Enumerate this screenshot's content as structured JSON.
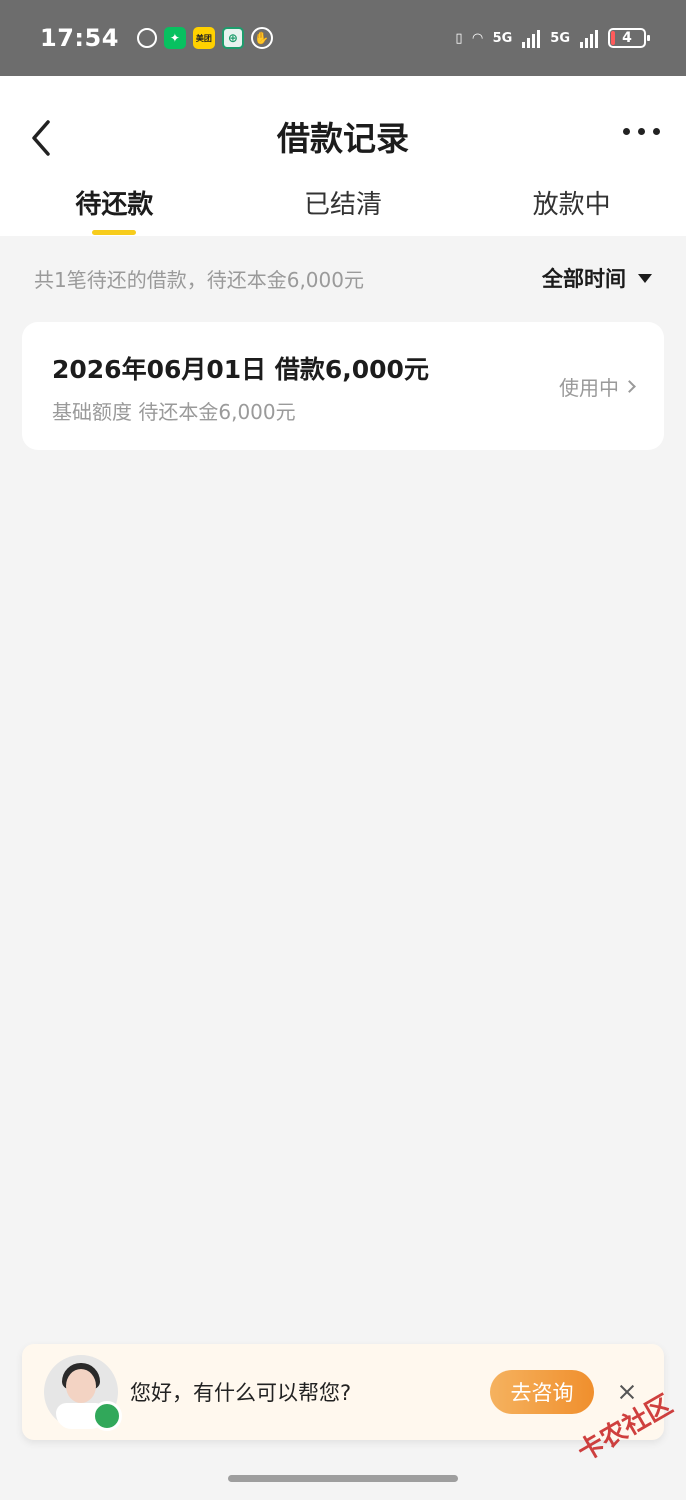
{
  "status_bar": {
    "time": "17:54",
    "battery": "4",
    "network_1": "5G",
    "network_2": "5G",
    "icons": [
      "alarm-icon",
      "wechat-icon",
      "meituan-icon",
      "bank-app-icon",
      "gesture-icon",
      "vibrate-icon",
      "wifi-icon",
      "signal-icon",
      "battery-icon"
    ],
    "meituan_label": "美团"
  },
  "header": {
    "title": "借款记录",
    "tabs": [
      {
        "label": "待还款",
        "active": true
      },
      {
        "label": "已结清",
        "active": false
      },
      {
        "label": "放款中",
        "active": false
      }
    ]
  },
  "summary": {
    "text": "共1笔待还的借款，待还本金6,000元",
    "filter_label": "全部时间"
  },
  "loans": [
    {
      "title": "2026年06月01日 借款6,000元",
      "subtitle": "基础额度 待还本金6,000元",
      "status": "使用中"
    }
  ],
  "chat": {
    "greeting": "您好，有什么可以帮您?",
    "button_label": "去咨询"
  },
  "watermark": "卡农社区",
  "colors": {
    "accent": "#f7cc1c",
    "consult_button": "#f08f2d",
    "background": "#f4f4f4"
  }
}
